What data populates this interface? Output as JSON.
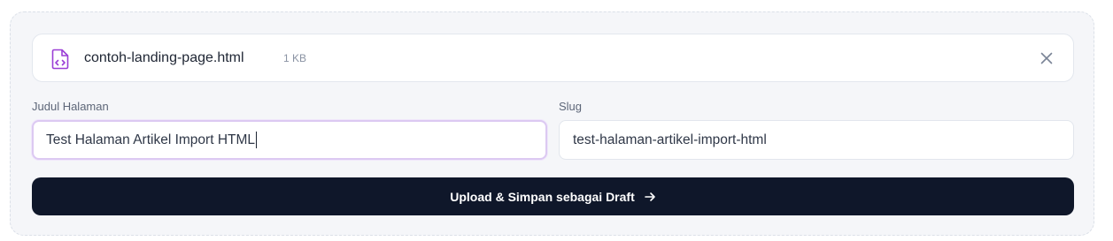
{
  "file": {
    "name": "contoh-landing-page.html",
    "size": "1 KB",
    "icon": "file-code-icon",
    "accent_color": "#9b3fd6"
  },
  "form": {
    "title_label": "Judul Halaman",
    "title_value": "Test Halaman Artikel Import HTML",
    "slug_label": "Slug",
    "slug_value": "test-halaman-artikel-import-html"
  },
  "actions": {
    "submit_label": "Upload & Simpan sebagai Draft",
    "submit_icon": "arrow-right-icon",
    "close_icon": "close-icon"
  },
  "colors": {
    "button_bg": "#0f172a",
    "focus_ring": "#dcc9f2"
  }
}
